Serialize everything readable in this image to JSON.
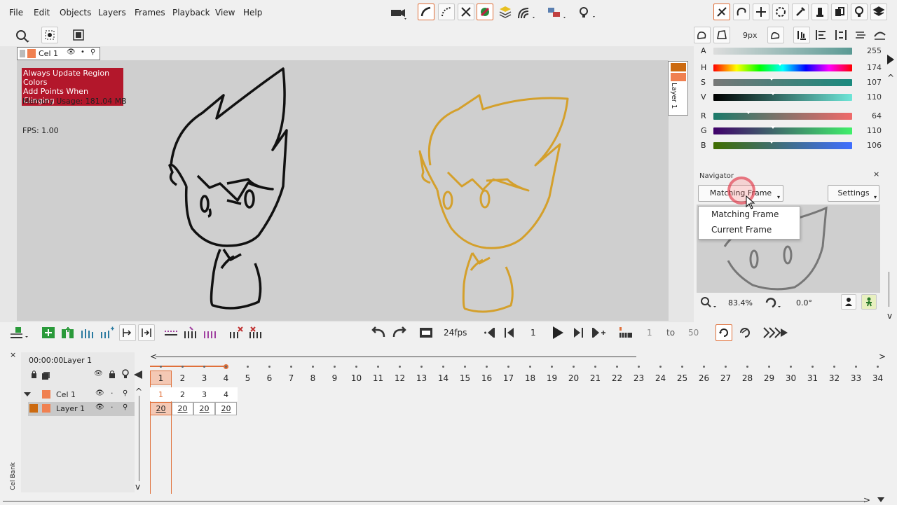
{
  "menu": [
    "File",
    "Edit",
    "Objects",
    "Layers",
    "Frames",
    "Playback",
    "View",
    "Help"
  ],
  "right_toolbar": {
    "brush_size": "9px"
  },
  "cel": {
    "name": "Cel 1"
  },
  "overlay": {
    "line1": "Always Update Region Colors",
    "line2": "Add Points When Clinging",
    "memory": "Memory Usage: 181.04 MB",
    "fps": "FPS: 1.00"
  },
  "side_layer_label": "Layer 1",
  "colors": {
    "accent": "#e0703a",
    "overlay_red": "#b3172b",
    "gold_stroke": "#d4a02c",
    "layer_orange": "#f08050",
    "layer_dark_orange": "#cc6a10"
  },
  "color_sliders": [
    {
      "label": "A",
      "value": "255",
      "fraction": 1.0
    },
    {
      "label": "H",
      "value": "174",
      "fraction": 0.48
    },
    {
      "label": "S",
      "value": "107",
      "fraction": 0.42
    },
    {
      "label": "V",
      "value": "110",
      "fraction": 0.43
    },
    {
      "label": "R",
      "value": "64",
      "fraction": 0.25
    },
    {
      "label": "G",
      "value": "110",
      "fraction": 0.43
    },
    {
      "label": "B",
      "value": "106",
      "fraction": 0.42
    }
  ],
  "navigator": {
    "title": "Navigator",
    "close": "×",
    "mode_selected": "Matching Frame",
    "settings_label": "Settings",
    "options": [
      "Matching Frame",
      "Current Frame"
    ],
    "zoom": "83.4%",
    "rotation": "0.0°"
  },
  "playback": {
    "fps": "24fps",
    "current_frame": "1",
    "range_start": "1",
    "range_to": "to",
    "range_end": "50"
  },
  "timeline": {
    "close": "×",
    "timecode": "00:00:00",
    "layer_name": "Layer 1",
    "frames": [
      "1",
      "2",
      "3",
      "4",
      "5",
      "6",
      "7",
      "8",
      "9",
      "10",
      "11",
      "12",
      "13",
      "14",
      "15",
      "16",
      "17",
      "18",
      "19",
      "20",
      "21",
      "22",
      "23",
      "24",
      "25",
      "26",
      "27",
      "28",
      "29",
      "30",
      "31",
      "32",
      "33",
      "34"
    ],
    "layers": [
      {
        "name": "Cel 1",
        "cells": [
          "1",
          "2",
          "3",
          "4"
        ]
      },
      {
        "name": "Layer 1",
        "cells": [
          "20",
          "20",
          "20",
          "20"
        ]
      }
    ],
    "cel_bank": "Cel Bank"
  }
}
